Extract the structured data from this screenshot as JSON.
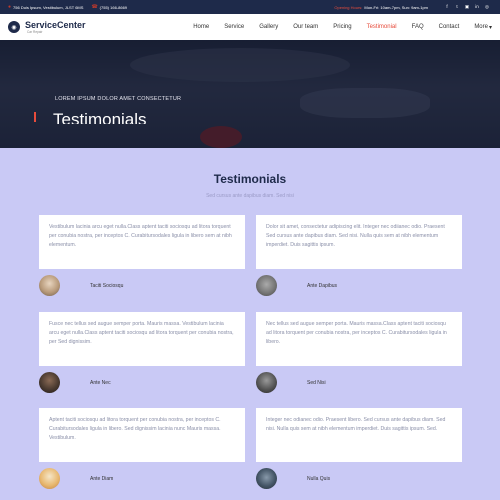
{
  "topbar": {
    "address": "756 Duis Ipsum, Vestibulum, JLST 6MS",
    "phone": "(755) 166-8669",
    "hours_label": "Opening Hours:",
    "hours": "Mon-Fri: 10am-7pm, Sun: 9am-1pm"
  },
  "brand": {
    "name": "ServiceCenter",
    "tagline": "Car Repair"
  },
  "nav": {
    "items": [
      "Home",
      "Service",
      "Gallery",
      "Our team",
      "Pricing",
      "Testimonial",
      "FAQ",
      "Contact",
      "More"
    ],
    "active": "Testimonial"
  },
  "hero": {
    "subtitle": "LOREM IPSUM DOLOR AMET CONSECTETUR",
    "title": "Testimonials"
  },
  "section": {
    "title": "Testimonials",
    "subtitle": "Sed cursus ante dapibus diam. Sed nisi"
  },
  "testimonials": [
    {
      "text": "Vestibulum lacinia arcu eget nulla.Class aptent taciti sociosqu ad litora torquent per conubia nostra, per inceptos C. Curabitursodales ligula in libero sem at nibh elementum.",
      "author": "Taciti Sociosqu"
    },
    {
      "text": "Dolor sit amet, consectetur adipiscing elit. Integer nec odiianec odio. Praesent Sed cursus ante dapibus diam. Sed nisi. Nulla quis sem at nibh elementum imperdiet. Duis sagittis ipsum.",
      "author": "Ante Dapibus"
    },
    {
      "text": "Fusce nec tellus sed augue semper porta. Mauris massa. Vestibulum lacinia arcu eget nulla.Class aptent taciti sociosqu ad litora torquent per conubia nostra, per Sed dignissim.",
      "author": "Ante Nec"
    },
    {
      "text": "Nec tellus sed augue semper porta. Mauris massa.Class aptent taciti sociosqu ad litora torquent per conubia nostra, per inceptos C. Curabitursodales ligula in libero.",
      "author": "Sed Nisi"
    },
    {
      "text": "Aptent taciti sociosqu ad litora torquent per conubia nostra, per inceptos C. Curabitursodales ligula in libero. Sed dignissim lacinia nunc Mauris massa. Vestibulum.",
      "author": "Ante Diam"
    },
    {
      "text": "Integer nec odianec odio. Praesent libero. Sed cursus ante dapibus diam. Sed nisi. Nulla quis sem at nibh elementum imperdiet. Duis sagittis ipsum. Sed.",
      "author": "Nulla Quis"
    }
  ],
  "colors": {
    "navy": "#1e2a4a",
    "accent_red": "#e74c3c",
    "section_bg": "#c9c9f5",
    "card_bg": "#ffffff",
    "body_text": "#8a8fa8"
  },
  "icons": {
    "address": "map-marker-icon",
    "phone": "phone-icon",
    "social": [
      "facebook-icon",
      "twitter-icon",
      "instagram-icon",
      "linkedin-icon",
      "dribbble-icon"
    ]
  }
}
